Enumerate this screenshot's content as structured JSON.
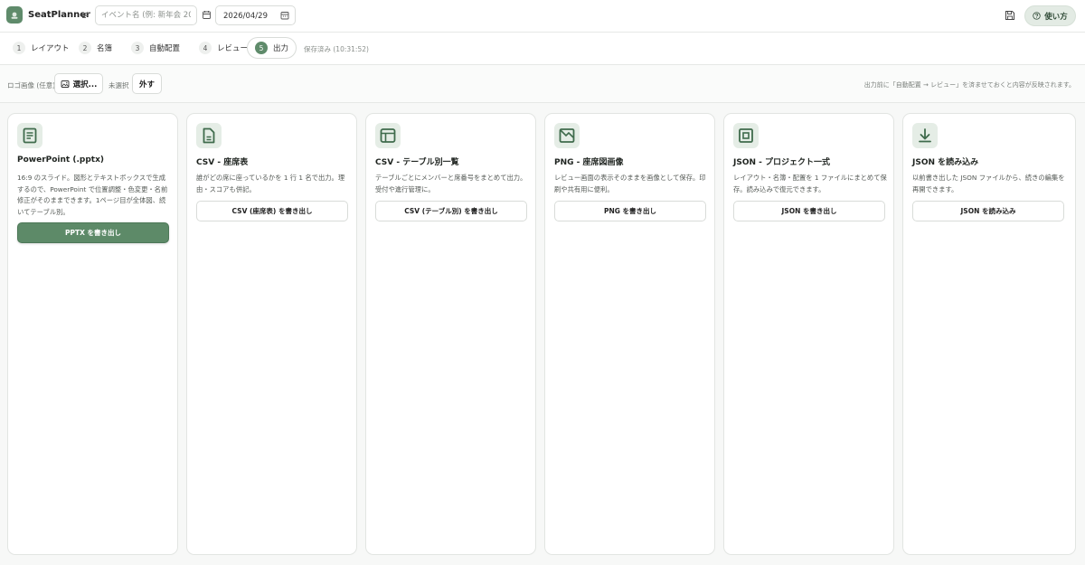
{
  "app": {
    "title": "SeatPlanner"
  },
  "header": {
    "event_placeholder": "イベント名 (例: 新年会 2026)",
    "date_value": "2026/04/29",
    "help_label": "使い方"
  },
  "steps": [
    {
      "num": "1",
      "label": "レイアウト"
    },
    {
      "num": "2",
      "label": "名簿"
    },
    {
      "num": "3",
      "label": "自動配置"
    },
    {
      "num": "4",
      "label": "レビュー"
    },
    {
      "num": "5",
      "label": "出力"
    }
  ],
  "saved_status": "保存済み (10:31:52)",
  "toolbar": {
    "logo_label": "ロゴ画像 (任意)",
    "select_label": "選択...",
    "unselected_label": "未選択",
    "remove_label": "外す",
    "hint": "出力前に「自動配置 → レビュー」を済ませておくと内容が反映されます。"
  },
  "cards": [
    {
      "icon": "document-icon",
      "title": "PowerPoint (.pptx)",
      "desc": "16:9 のスライド。図形とテキストボックスで生成するので、PowerPoint で位置調整・色変更・名前修正がそのままできます。1ページ目が全体図、続いてテーブル別。",
      "button": "PPTX を書き出し"
    },
    {
      "icon": "file-icon",
      "title": "CSV - 座席表",
      "desc": "誰がどの席に座っているかを 1 行 1 名で出力。理由・スコアも併記。",
      "button": "CSV (座席表) を書き出し"
    },
    {
      "icon": "table-icon",
      "title": "CSV - テーブル別一覧",
      "desc": "テーブルごとにメンバーと席番号をまとめて出力。受付や進行管理に。",
      "button": "CSV (テーブル別) を書き出し"
    },
    {
      "icon": "image-icon",
      "title": "PNG - 座席図画像",
      "desc": "レビュー画面の表示そのままを画像として保存。印刷や共有用に便利。",
      "button": "PNG を書き出し"
    },
    {
      "icon": "project-icon",
      "title": "JSON - プロジェクト一式",
      "desc": "レイアウト・名簿・配置を 1 ファイルにまとめて保存。読み込みで復元できます。",
      "button": "JSON を書き出し"
    },
    {
      "icon": "download-icon",
      "title": "JSON を読み込み",
      "desc": "以前書き出した JSON ファイルから、続きの編集を再開できます。",
      "button": "JSON を読み込み"
    }
  ],
  "colors": {
    "accent": "#5d8a68",
    "accent_light": "#e5ede6"
  }
}
